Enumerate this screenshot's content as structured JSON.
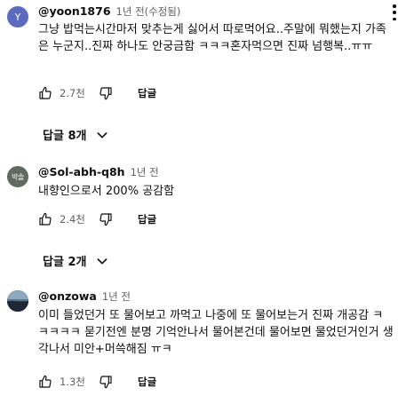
{
  "comments": [
    {
      "avatar_letter": "Y",
      "author": "@yoon1876",
      "time": "1년 전(수정됨)",
      "text": "그냥 밥먹는시간마저 맞추는게 싫어서 따로먹어요..주말에 뭐했는지 가족은 누군지..진짜 하나도 안궁금함 ㅋㅋㅋ혼자먹으면 진짜 넘행복..ㅠㅠ",
      "likes": "2.7천",
      "reply_label": "답글",
      "replies_label": "답글 8개"
    },
    {
      "avatar_text": "박솔",
      "author": "@Sol-abh-q8h",
      "time": "1년 전",
      "text": "내향인으로서 200% 공감함",
      "likes": "2.4천",
      "reply_label": "답글",
      "replies_label": "답글 2개"
    },
    {
      "author": "@onzowa",
      "time": "1년 전",
      "text": "이미 들었던거 또 물어보고 까먹고 나중에 또 물어보는거 진짜 개공감 ㅋㅋㅋㅋㅋ 묻기전엔 분명 기억안나서 물어본건데 물어보면 물었던거인거 생각나서 미안+머쓱해짐 ㅠㅋ",
      "likes": "1.3천",
      "reply_label": "답글"
    }
  ],
  "icons": {
    "like": "thumb-up-icon",
    "dislike": "thumb-down-icon",
    "more": "more-vert-icon",
    "expand": "chevron-down-icon"
  },
  "colors": {
    "avatar_y": "#5c6bc0",
    "avatar_sol": "#5f6b5e",
    "secondary_text": "#606060"
  }
}
